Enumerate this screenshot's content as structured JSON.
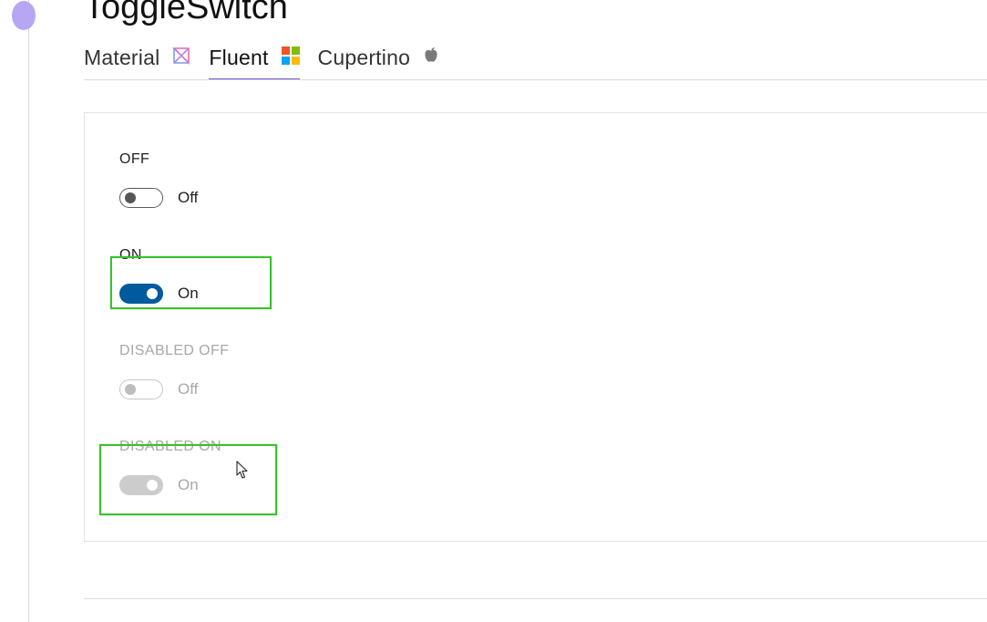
{
  "page": {
    "title": "ToggleSwitch"
  },
  "tabs": [
    {
      "label": "Material",
      "icon": "material-icon",
      "active": false
    },
    {
      "label": "Fluent",
      "icon": "windows-icon",
      "active": true
    },
    {
      "label": "Cupertino",
      "icon": "apple-icon",
      "active": false
    }
  ],
  "sections": {
    "off": {
      "header": "OFF",
      "state_text": "Off",
      "checked": false,
      "disabled": false
    },
    "on": {
      "header": "ON",
      "state_text": "On",
      "checked": true,
      "disabled": false
    },
    "disabled_off": {
      "header": "DISABLED OFF",
      "state_text": "Off",
      "checked": false,
      "disabled": true
    },
    "disabled_on": {
      "header": "DISABLED ON",
      "state_text": "On",
      "checked": true,
      "disabled": true
    }
  },
  "colors": {
    "accent_on": "#005a9e",
    "tab_underline": "#6a5ad0",
    "highlight": "#38c12c",
    "disabled": "#a8a8a8"
  }
}
